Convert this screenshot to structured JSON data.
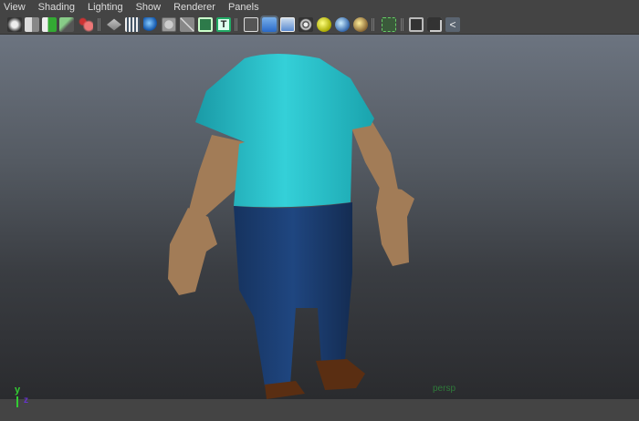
{
  "menu": [
    "View",
    "Shading",
    "Lighting",
    "Show",
    "Renderer",
    "Panels"
  ],
  "toolbar_icons": [
    "camera-select-icon",
    "camera-attributes-icon",
    "bookmark-icon",
    "image-plane-icon",
    "grease-pencil-icon",
    "grid-icon",
    "film-gate-icon",
    "resolution-gate-icon",
    "gate-mask-icon",
    "field-chart-icon",
    "safe-action-icon",
    "safe-title-icon",
    "wireframe-icon",
    "smooth-shade-icon",
    "wireframe-on-shaded-icon",
    "textured-icon",
    "use-all-lights-icon",
    "shadows-icon",
    "screen-space-ao-icon",
    "isolate-select-icon",
    "xray-icon",
    "xray-joints-icon",
    "node-editor-icon"
  ],
  "viewport": {
    "camera_label": "persp",
    "axis_y": "y",
    "axis_z": "z"
  },
  "colors": {
    "shirt": "#2ec4cc",
    "pants": "#1b3d73",
    "skin": "#a7805a",
    "shoes": "#5a2e12"
  }
}
